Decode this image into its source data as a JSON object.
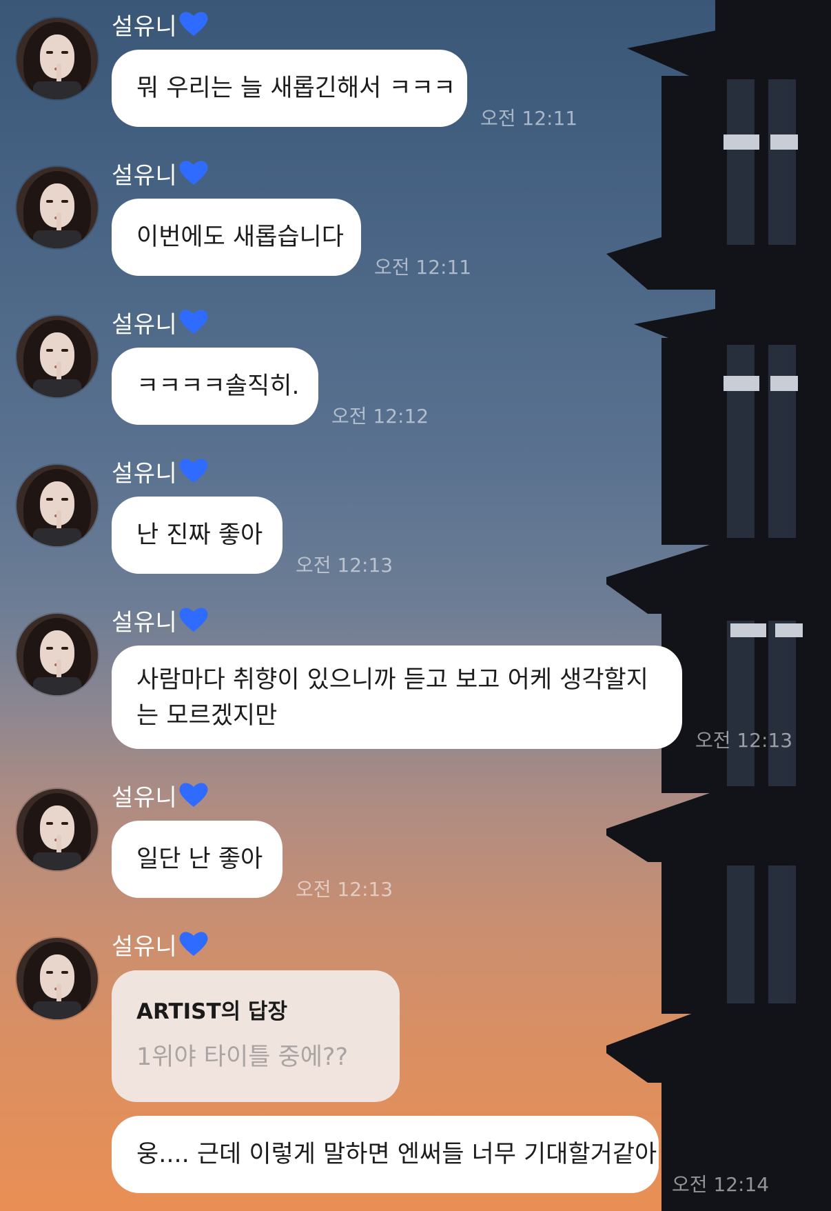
{
  "sender": {
    "name": "설유니",
    "heart_icon": "blue-heart-icon",
    "heart_color": "#2f6bff"
  },
  "messages": [
    {
      "text": "뭐 우리는 늘 새롭긴해서 ㅋㅋㅋ",
      "time": "오전 12:11"
    },
    {
      "text": "이번에도 새롭습니다",
      "time": "오전 12:11"
    },
    {
      "text": "ㅋㅋㅋㅋ솔직히.",
      "time": "오전 12:12"
    },
    {
      "text": "난 진짜 좋아",
      "time": "오전 12:13"
    },
    {
      "text": "사람마다 취향이 있으니까 듣고 보고 어케 생각할지는 모르겠지만",
      "time": "오전 12:13"
    },
    {
      "text": "일단 난 좋아",
      "time": "오전 12:13"
    },
    {
      "reply": {
        "title": "ARTIST의 답장",
        "quote": "1위야 타이틀 중에??"
      },
      "text": "웅.... 근데 이렇게 말하면 엔써들 너무 기대할거같아",
      "time": "오전 12:14"
    }
  ]
}
